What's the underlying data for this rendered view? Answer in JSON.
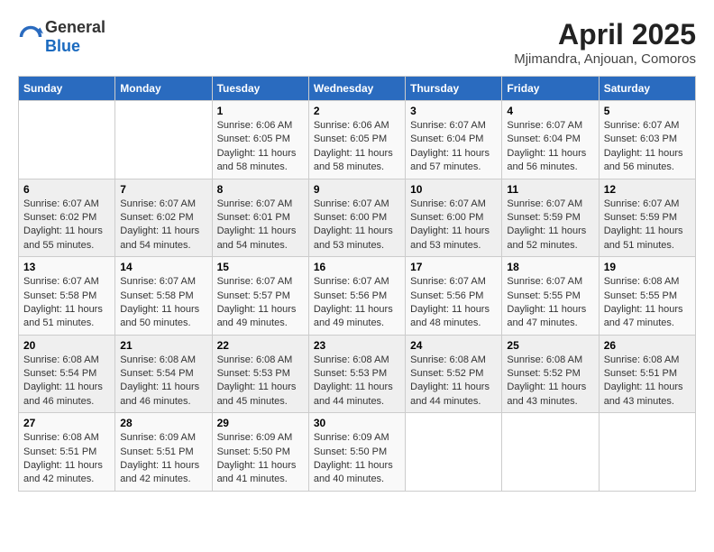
{
  "header": {
    "logo_general": "General",
    "logo_blue": "Blue",
    "title": "April 2025",
    "subtitle": "Mjimandra, Anjouan, Comoros"
  },
  "weekdays": [
    "Sunday",
    "Monday",
    "Tuesday",
    "Wednesday",
    "Thursday",
    "Friday",
    "Saturday"
  ],
  "weeks": [
    [
      {
        "day": "",
        "info": ""
      },
      {
        "day": "",
        "info": ""
      },
      {
        "day": "1",
        "info": "Sunrise: 6:06 AM\nSunset: 6:05 PM\nDaylight: 11 hours and 58 minutes."
      },
      {
        "day": "2",
        "info": "Sunrise: 6:06 AM\nSunset: 6:05 PM\nDaylight: 11 hours and 58 minutes."
      },
      {
        "day": "3",
        "info": "Sunrise: 6:07 AM\nSunset: 6:04 PM\nDaylight: 11 hours and 57 minutes."
      },
      {
        "day": "4",
        "info": "Sunrise: 6:07 AM\nSunset: 6:04 PM\nDaylight: 11 hours and 56 minutes."
      },
      {
        "day": "5",
        "info": "Sunrise: 6:07 AM\nSunset: 6:03 PM\nDaylight: 11 hours and 56 minutes."
      }
    ],
    [
      {
        "day": "6",
        "info": "Sunrise: 6:07 AM\nSunset: 6:02 PM\nDaylight: 11 hours and 55 minutes."
      },
      {
        "day": "7",
        "info": "Sunrise: 6:07 AM\nSunset: 6:02 PM\nDaylight: 11 hours and 54 minutes."
      },
      {
        "day": "8",
        "info": "Sunrise: 6:07 AM\nSunset: 6:01 PM\nDaylight: 11 hours and 54 minutes."
      },
      {
        "day": "9",
        "info": "Sunrise: 6:07 AM\nSunset: 6:00 PM\nDaylight: 11 hours and 53 minutes."
      },
      {
        "day": "10",
        "info": "Sunrise: 6:07 AM\nSunset: 6:00 PM\nDaylight: 11 hours and 53 minutes."
      },
      {
        "day": "11",
        "info": "Sunrise: 6:07 AM\nSunset: 5:59 PM\nDaylight: 11 hours and 52 minutes."
      },
      {
        "day": "12",
        "info": "Sunrise: 6:07 AM\nSunset: 5:59 PM\nDaylight: 11 hours and 51 minutes."
      }
    ],
    [
      {
        "day": "13",
        "info": "Sunrise: 6:07 AM\nSunset: 5:58 PM\nDaylight: 11 hours and 51 minutes."
      },
      {
        "day": "14",
        "info": "Sunrise: 6:07 AM\nSunset: 5:58 PM\nDaylight: 11 hours and 50 minutes."
      },
      {
        "day": "15",
        "info": "Sunrise: 6:07 AM\nSunset: 5:57 PM\nDaylight: 11 hours and 49 minutes."
      },
      {
        "day": "16",
        "info": "Sunrise: 6:07 AM\nSunset: 5:56 PM\nDaylight: 11 hours and 49 minutes."
      },
      {
        "day": "17",
        "info": "Sunrise: 6:07 AM\nSunset: 5:56 PM\nDaylight: 11 hours and 48 minutes."
      },
      {
        "day": "18",
        "info": "Sunrise: 6:07 AM\nSunset: 5:55 PM\nDaylight: 11 hours and 47 minutes."
      },
      {
        "day": "19",
        "info": "Sunrise: 6:08 AM\nSunset: 5:55 PM\nDaylight: 11 hours and 47 minutes."
      }
    ],
    [
      {
        "day": "20",
        "info": "Sunrise: 6:08 AM\nSunset: 5:54 PM\nDaylight: 11 hours and 46 minutes."
      },
      {
        "day": "21",
        "info": "Sunrise: 6:08 AM\nSunset: 5:54 PM\nDaylight: 11 hours and 46 minutes."
      },
      {
        "day": "22",
        "info": "Sunrise: 6:08 AM\nSunset: 5:53 PM\nDaylight: 11 hours and 45 minutes."
      },
      {
        "day": "23",
        "info": "Sunrise: 6:08 AM\nSunset: 5:53 PM\nDaylight: 11 hours and 44 minutes."
      },
      {
        "day": "24",
        "info": "Sunrise: 6:08 AM\nSunset: 5:52 PM\nDaylight: 11 hours and 44 minutes."
      },
      {
        "day": "25",
        "info": "Sunrise: 6:08 AM\nSunset: 5:52 PM\nDaylight: 11 hours and 43 minutes."
      },
      {
        "day": "26",
        "info": "Sunrise: 6:08 AM\nSunset: 5:51 PM\nDaylight: 11 hours and 43 minutes."
      }
    ],
    [
      {
        "day": "27",
        "info": "Sunrise: 6:08 AM\nSunset: 5:51 PM\nDaylight: 11 hours and 42 minutes."
      },
      {
        "day": "28",
        "info": "Sunrise: 6:09 AM\nSunset: 5:51 PM\nDaylight: 11 hours and 42 minutes."
      },
      {
        "day": "29",
        "info": "Sunrise: 6:09 AM\nSunset: 5:50 PM\nDaylight: 11 hours and 41 minutes."
      },
      {
        "day": "30",
        "info": "Sunrise: 6:09 AM\nSunset: 5:50 PM\nDaylight: 11 hours and 40 minutes."
      },
      {
        "day": "",
        "info": ""
      },
      {
        "day": "",
        "info": ""
      },
      {
        "day": "",
        "info": ""
      }
    ]
  ]
}
